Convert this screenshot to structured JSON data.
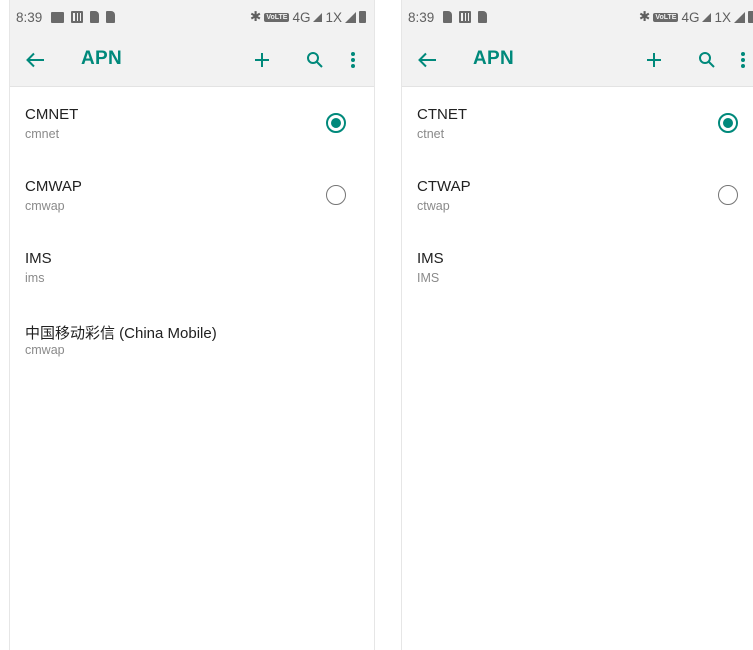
{
  "colors": {
    "accent": "#00897b",
    "header_bg": "#f2f2f2",
    "text_primary": "#212121",
    "text_secondary": "#8a8a8a"
  },
  "left": {
    "status": {
      "time": "8:39",
      "network": "4G",
      "signal2": "1X",
      "volte": "VoLTE"
    },
    "toolbar": {
      "title": "APN",
      "icons": [
        "back-arrow-icon",
        "add-icon",
        "search-icon",
        "more-vert-icon"
      ]
    },
    "apns": [
      {
        "name": "CMNET",
        "apn": "cmnet",
        "selected": true,
        "has_radio": true
      },
      {
        "name": "CMWAP",
        "apn": "cmwap",
        "selected": false,
        "has_radio": true
      },
      {
        "name": "IMS",
        "apn": "ims",
        "has_radio": false
      },
      {
        "name": "中国移动彩信 (China Mobile)",
        "apn": "cmwap",
        "has_radio": false
      }
    ]
  },
  "right": {
    "status": {
      "time": "8:39",
      "network": "4G",
      "signal2": "1X",
      "volte": "VoLTE"
    },
    "toolbar": {
      "title": "APN",
      "icons": [
        "back-arrow-icon",
        "add-icon",
        "search-icon",
        "more-vert-icon"
      ]
    },
    "apns": [
      {
        "name": "CTNET",
        "apn": "ctnet",
        "selected": true,
        "has_radio": true
      },
      {
        "name": "CTWAP",
        "apn": "ctwap",
        "selected": false,
        "has_radio": true
      },
      {
        "name": "IMS",
        "apn": "IMS",
        "has_radio": false
      }
    ]
  }
}
